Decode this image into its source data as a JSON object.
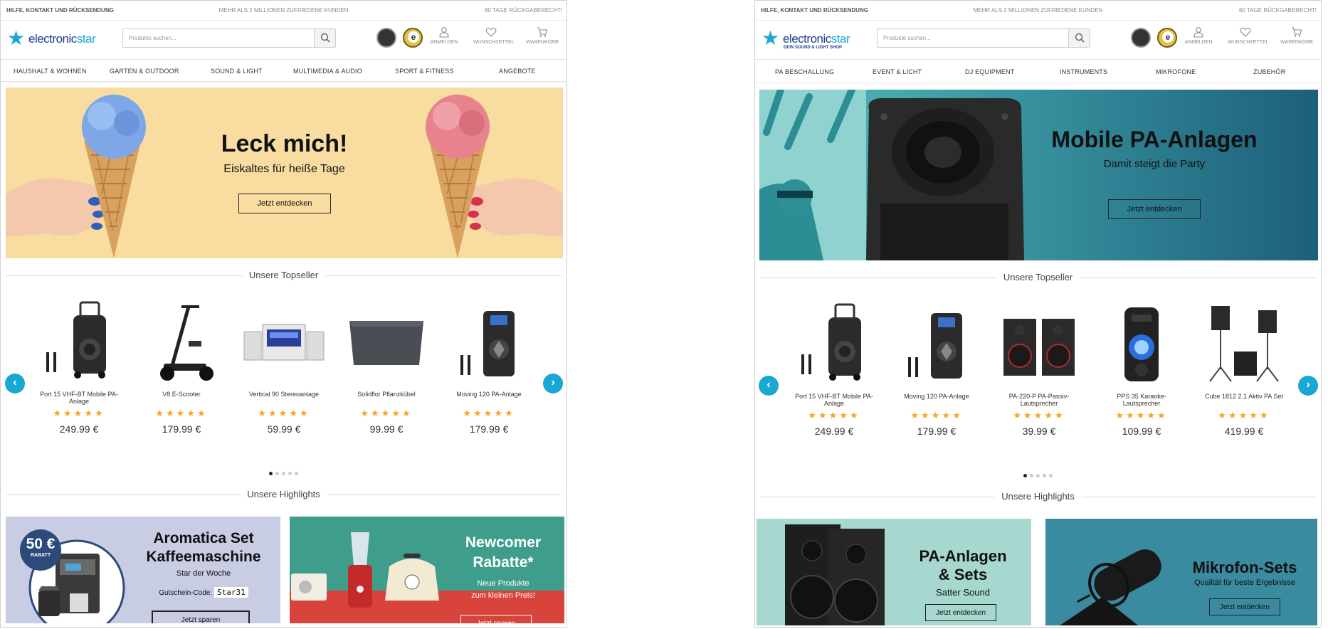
{
  "left": {
    "topbar": {
      "left": "HILFE, KONTAKT UND RÜCKSENDUNG",
      "center": "MEHR ALS 2 MILLIONEN ZUFRIEDENE KUNDEN",
      "right": "60 TAGE RÜCKGABERECHT!"
    },
    "logo": {
      "text_a": "electronic",
      "text_b": "star",
      "sub": ""
    },
    "search": {
      "placeholder": "Produkte suchen..."
    },
    "header_icons": {
      "login": "ANMELDEN",
      "wishlist": "WUNSCHZETTEL",
      "cart": "WARENKORB"
    },
    "nav": [
      "HAUSHALT & WOHNEN",
      "GARTEN & OUTDOOR",
      "SOUND & LIGHT",
      "MULTIMEDIA & AUDIO",
      "SPORT & FITNESS",
      "ANGEBOTE"
    ],
    "hero": {
      "title": "Leck mich!",
      "subtitle": "Eiskaltes für heiße Tage",
      "button": "Jetzt entdecken"
    },
    "topseller_title": "Unsere Topseller",
    "products": [
      {
        "name": "Port 15 VHF-BT Mobile PA-Anlage",
        "stars": "★★★★★",
        "price": "249.99 €"
      },
      {
        "name": "V8 E-Scooter",
        "stars": "★★★★★",
        "price": "179.99 €"
      },
      {
        "name": "Vertical 90 Stereoanlage",
        "stars": "★★★★★",
        "price": "59.99 €"
      },
      {
        "name": "Solidflor Pflanzkübel",
        "stars": "★★★★★",
        "price": "99.99 €"
      },
      {
        "name": "Moving 120 PA-Anlage",
        "stars": "★★★★★",
        "price": "179.99 €"
      }
    ],
    "highlights_title": "Unsere Highlights",
    "tile1": {
      "badge_amount": "50 €",
      "badge_label": "RABATT",
      "title_1": "Aromatica Set",
      "title_2": "Kaffeemaschine",
      "subtitle": "Star der Woche",
      "code_label": "Gutschein-Code:",
      "code": "Star31",
      "button": "Jetzt sparen"
    },
    "tile2": {
      "title_1": "Newcomer",
      "title_2": "Rabatte*",
      "sub_1": "Neue Produkte",
      "sub_2": "zum kleinen Preis!",
      "button": "Jetzt sparen"
    }
  },
  "right": {
    "topbar": {
      "left": "HILFE, KONTAKT UND RÜCKSENDUNG",
      "center": "MEHR ALS 2 MILLIONEN ZUFRIEDENE KUNDEN",
      "right": "60 TAGE RÜCKGABERECHT!"
    },
    "logo": {
      "text_a": "electronic",
      "text_b": "star",
      "sub": "DEIN SOUND & LIGHT SHOP"
    },
    "search": {
      "placeholder": "Produkte suchen..."
    },
    "header_icons": {
      "login": "ANMELDEN",
      "wishlist": "WUNSCHZETTEL",
      "cart": "WARENKORB"
    },
    "nav": [
      "PA BESCHALLUNG",
      "EVENT & LICHT",
      "DJ EQUIPMENT",
      "INSTRUMENTS",
      "MIKROFONE",
      "ZUBEHÖR"
    ],
    "hero": {
      "title": "Mobile PA-Anlagen",
      "subtitle": "Damit steigt die Party",
      "button": "Jetzt entdecken"
    },
    "topseller_title": "Unsere Topseller",
    "products": [
      {
        "name": "Port 15 VHF-BT Mobile PA-Anlage",
        "stars": "★★★★★",
        "price": "249.99 €"
      },
      {
        "name": "Moving 120 PA-Anlage",
        "stars": "★★★★★",
        "price": "179.99 €"
      },
      {
        "name": "PA-220-P PA-Passiv-Lautsprecher",
        "stars": "★★★★★",
        "price": "39.99 €"
      },
      {
        "name": "PPS 35 Karaoke-Lautsprecher",
        "stars": "★★★★★",
        "price": "109.99 €"
      },
      {
        "name": "Cube 1812 2.1 Aktiv PA Set",
        "stars": "★★★★★",
        "price": "419.99 €"
      }
    ],
    "highlights_title": "Unsere Highlights",
    "tile1": {
      "title_1": "PA-Anlagen",
      "title_2": "& Sets",
      "subtitle": "Satter Sound",
      "button": "Jetzt entdecken"
    },
    "tile2": {
      "title": "Mikrofon-Sets",
      "subtitle": "Qualität für beste Ergebnisse",
      "button": "Jetzt entdecken"
    }
  },
  "colors": {
    "accent": "#1ba7d3",
    "brand": "#1d3d8f",
    "stars": "#f5a623",
    "hero_left_bg": "#f8dca0",
    "hero_right_bg": "#45b3b6",
    "tile_coffee_bg": "#c9cde3",
    "tile_newcomer_bg": "#3f9d8c",
    "tile_pa_bg": "#a7d8cf",
    "tile_mic_bg": "#3a8aa0"
  }
}
